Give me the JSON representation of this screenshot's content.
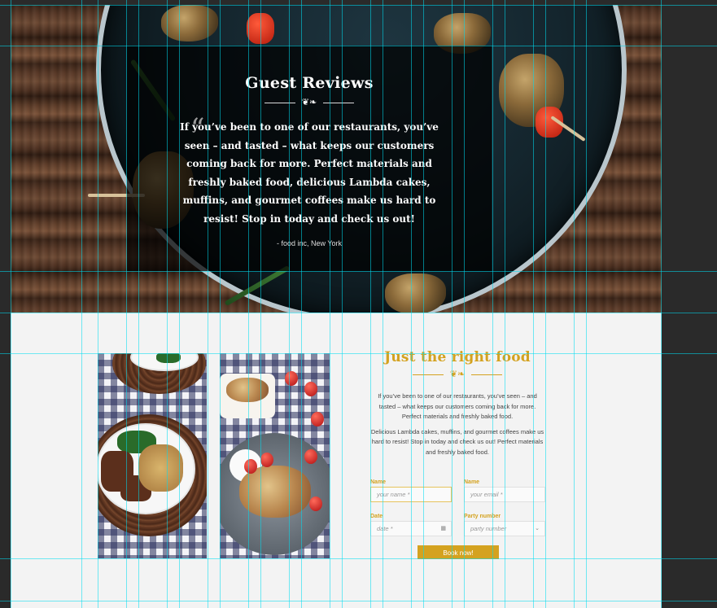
{
  "hero": {
    "title": "Guest Reviews",
    "quote_mark": "“",
    "review_text": "If you’ve been to one of our restaurants, you’ve seen – and tasted – what keeps our customers coming back for more. Perfect materials and freshly baked food, delicious Lambda cakes,  muffins, and gourmet coffees make us hard to resist! Stop in today and check us out!",
    "author": "- food inc, New York"
  },
  "info": {
    "title": "Just the right food",
    "paragraph1": "If you’ve been to one of our restaurants, you’ve seen – and tasted – what keeps our customers coming back for more. Perfect materials and freshly baked food.",
    "paragraph2": "Delicious Lambda cakes,  muffins, and gourmet coffees make us hard to resist! Stop in today and check us out! Perfect materials and  freshly baked food."
  },
  "form": {
    "name_label": "Name",
    "name_placeholder": "your name *",
    "email_label": "Name",
    "email_placeholder": "your email *",
    "date_label": "Date",
    "date_placeholder": "date *",
    "party_label": "Party number",
    "party_placeholder": "party number",
    "submit_label": "Book now!"
  },
  "colors": {
    "accent": "#d4a21f",
    "background": "#2a2a2a",
    "section_bg": "#f3f3f3"
  },
  "icons": {
    "calendar": "calendar-icon",
    "dropdown": "chevron-down-icon",
    "ornament": "ornament-flourish-icon"
  }
}
